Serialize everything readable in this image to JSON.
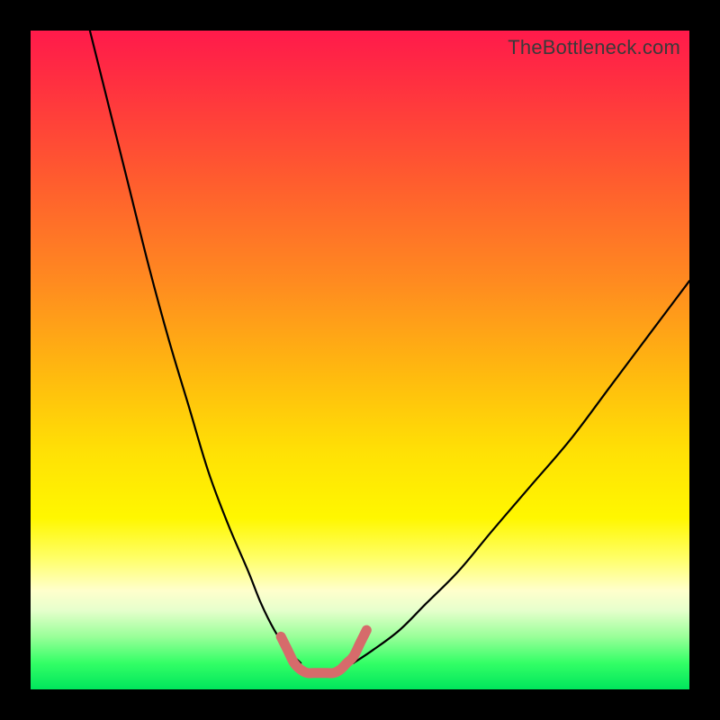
{
  "watermark": "TheBottleneck.com",
  "chart_data": {
    "type": "line",
    "title": "",
    "xlabel": "",
    "ylabel": "",
    "xlim": [
      0,
      100
    ],
    "ylim": [
      0,
      100
    ],
    "grid": false,
    "legend": false,
    "series": [
      {
        "name": "bottleneck-curve-left",
        "color": "#000000",
        "x": [
          9,
          12,
          15,
          18,
          21,
          24,
          27,
          30,
          33,
          35,
          37,
          39,
          41
        ],
        "values": [
          100,
          88,
          76,
          64,
          53,
          43,
          33,
          25,
          18,
          13,
          9,
          6,
          4
        ]
      },
      {
        "name": "bottleneck-curve-right",
        "color": "#000000",
        "x": [
          49,
          52,
          56,
          60,
          65,
          70,
          76,
          82,
          88,
          94,
          100
        ],
        "values": [
          4,
          6,
          9,
          13,
          18,
          24,
          31,
          38,
          46,
          54,
          62
        ]
      },
      {
        "name": "optimal-zone-marker",
        "color": "#d66b6b",
        "x": [
          38,
          39,
          40,
          41,
          42,
          43,
          44,
          45,
          46,
          47,
          48,
          49,
          50,
          51
        ],
        "values": [
          8,
          6,
          4,
          3,
          2.5,
          2.5,
          2.5,
          2.5,
          2.5,
          3,
          4,
          5,
          7,
          9
        ]
      }
    ]
  }
}
